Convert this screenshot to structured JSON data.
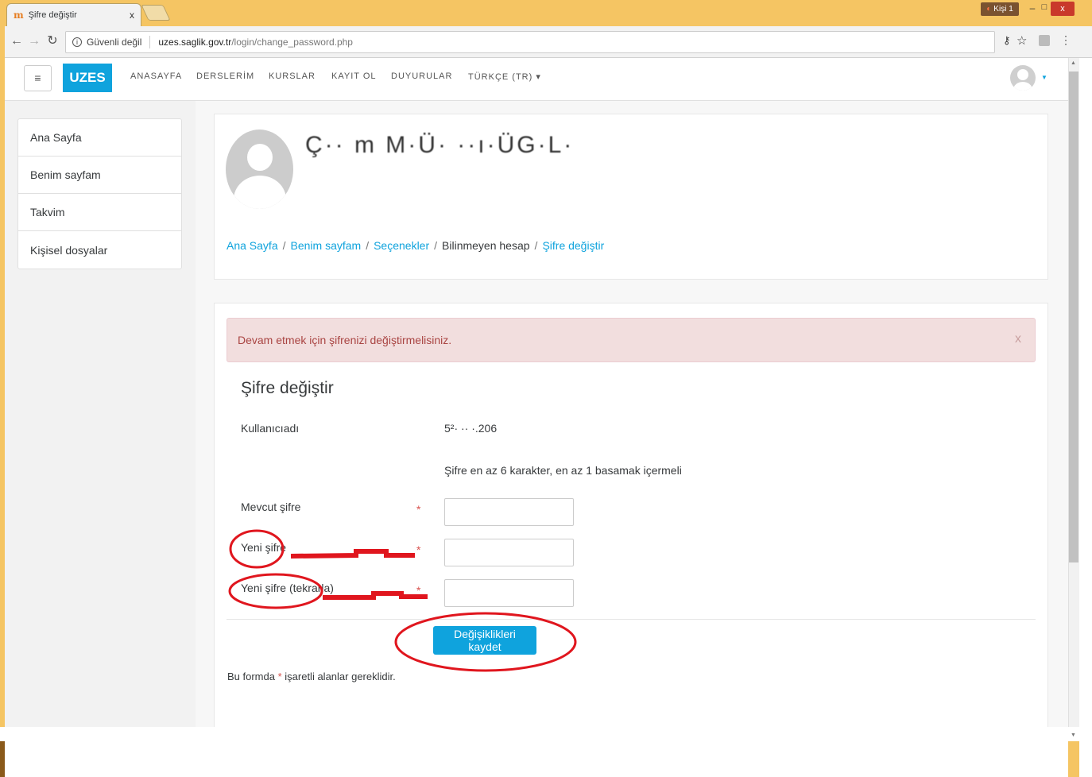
{
  "browser": {
    "tab_title": "Şifre değiştir",
    "tab_favicon": "m",
    "tab_close": "x",
    "profile_label": "Kişi 1",
    "win_min": "–",
    "win_max": "□",
    "win_close": "x",
    "omnibox": {
      "security_label": "Güvenli değil",
      "domain": "uzes.saglik.gov.tr",
      "path": "/login/change_password.php"
    }
  },
  "navbar": {
    "hamburger": "≡",
    "brand": "UZES",
    "links": [
      "ANASAYFA",
      "DERSLERİM",
      "KURSLAR",
      "KAYIT OL",
      "DUYURULAR",
      "TÜRKÇE (TR) ▾"
    ]
  },
  "sidebar": {
    "items": [
      {
        "label": "Ana Sayfa"
      },
      {
        "label": "Benim sayfam"
      },
      {
        "label": "Takvim"
      },
      {
        "label": "Kişisel dosyalar"
      }
    ]
  },
  "header": {
    "user_name": "Ç·· m M·Ü·   ··ı·ÜG·L·",
    "breadcrumb": [
      {
        "label": "Ana Sayfa",
        "link": true
      },
      {
        "label": "Benim sayfam",
        "link": true
      },
      {
        "label": "Seçenekler",
        "link": true
      },
      {
        "label": "Bilinmeyen hesap",
        "link": false
      },
      {
        "label": "Şifre değiştir",
        "link": true
      }
    ],
    "breadcrumb_sep": "/"
  },
  "alert": {
    "message": "Devam etmek için şifrenizi değiştirmelisiniz.",
    "close": "x"
  },
  "form": {
    "title": "Şifre değiştir",
    "username_label": "Kullanıcıadı",
    "username_value": "5²· ·· ·.206",
    "policy": "Şifre en az 6 karakter, en az 1 basamak içermeli",
    "current_label": "Mevcut şifre",
    "new_label": "Yeni şifre",
    "new_repeat_label": "Yeni şifre (tekrarla)",
    "required_mark": "*",
    "current_value": "",
    "new_value": "",
    "new_repeat_value": "",
    "save_label": "Değişiklikleri kaydet",
    "note_prefix": "Bu formda ",
    "note_star": "*",
    "note_suffix": " işaretli alanlar gereklidir."
  },
  "colors": {
    "accent": "#0fa3dd",
    "alert_bg": "#f2dede",
    "alert_text": "#a94442",
    "required": "#d9534f",
    "annotation": "#e0161e",
    "chrome": "#f5c563"
  },
  "icons": [
    "back-arrow-icon",
    "forward-arrow-icon",
    "reload-icon",
    "info-icon",
    "key-icon",
    "star-icon",
    "pdf-icon",
    "menu-icon",
    "user-avatar-icon",
    "close-icon"
  ]
}
